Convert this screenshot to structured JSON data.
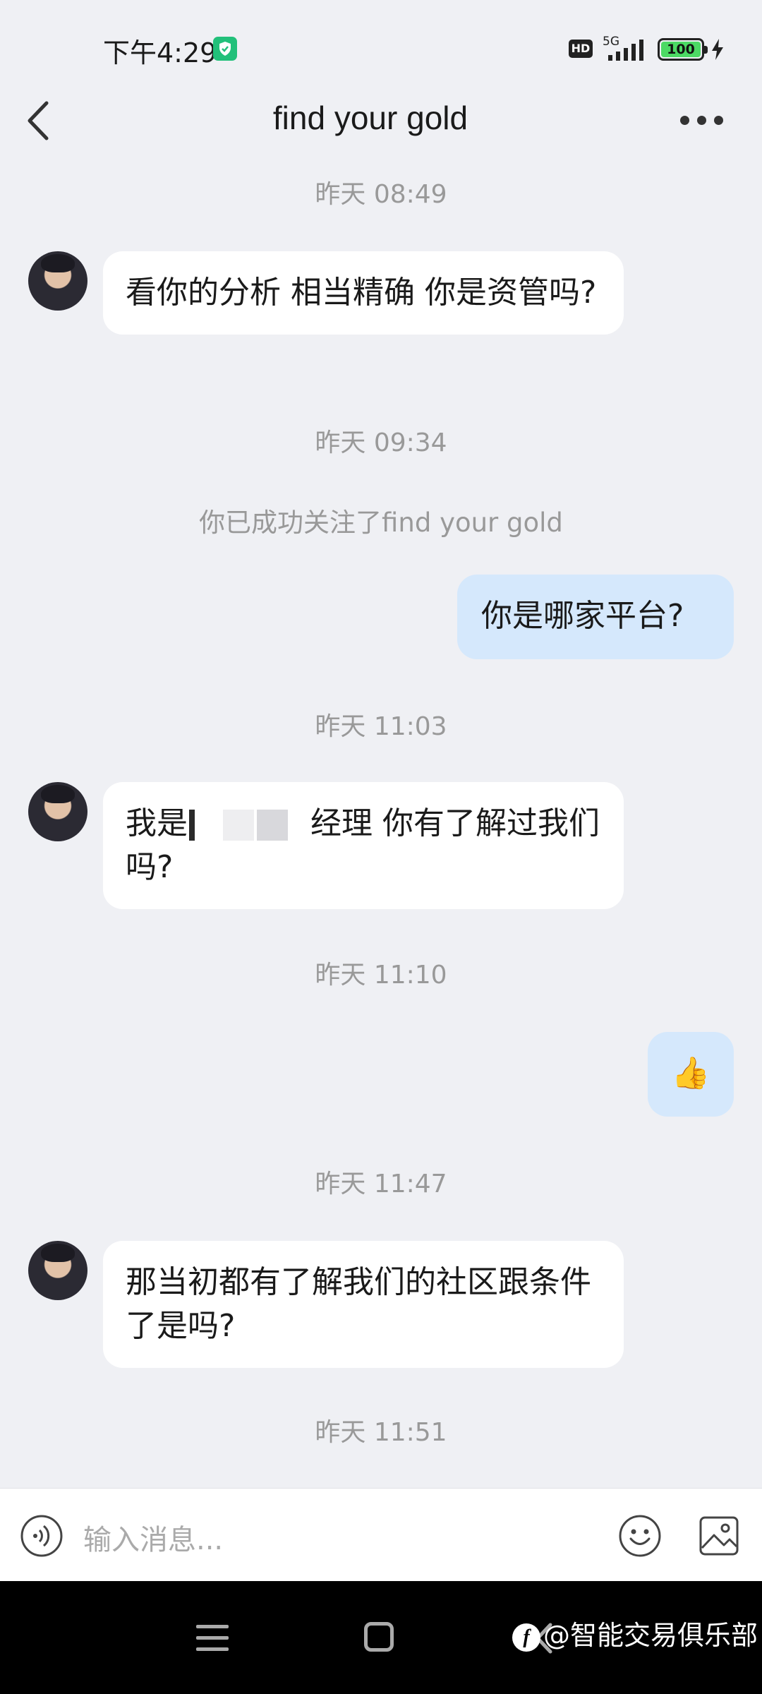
{
  "status_bar": {
    "time": "下午4:29",
    "hd": "HD",
    "network": "5G",
    "battery": "100"
  },
  "header": {
    "title": "find your gold"
  },
  "messages": {
    "ts1": "昨天 08:49",
    "m1": "看你的分析 相当精确 你是资管吗?",
    "ts2": "昨天 09:34",
    "system1": "你已成功关注了find your gold",
    "m2": "你是哪家平台?",
    "ts3": "昨天 11:03",
    "m3_pre": "我是",
    "m3_post": "经理 你有了解过我们吗?",
    "ts4": "昨天 11:10",
    "m4": "👍",
    "ts5": "昨天 11:47",
    "m5": "那当初都有了解我们的社区跟条件了是吗?",
    "ts6": "昨天 11:51"
  },
  "input": {
    "placeholder": "输入消息..."
  },
  "watermark": {
    "logo": "f",
    "text": "@智能交易俱乐部"
  }
}
